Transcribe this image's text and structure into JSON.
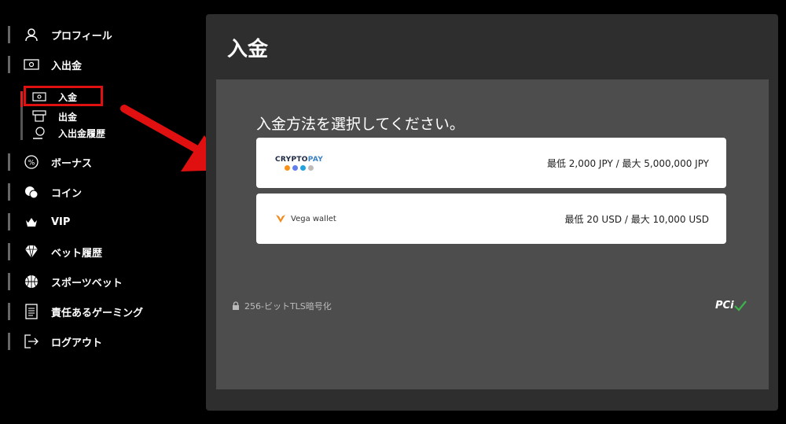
{
  "sidebar": {
    "items": [
      {
        "label": "プロフィール",
        "icon": "user-icon"
      },
      {
        "label": "入出金",
        "icon": "cash-icon"
      },
      {
        "label": "ボーナス",
        "icon": "percent-icon"
      },
      {
        "label": "コイン",
        "icon": "coins-icon"
      },
      {
        "label": "VIP",
        "icon": "vip-icon"
      },
      {
        "label": "ベット履歴",
        "icon": "diamond-icon"
      },
      {
        "label": "スポーツベット",
        "icon": "basketball-icon"
      },
      {
        "label": "責任あるゲーミング",
        "icon": "document-icon"
      },
      {
        "label": "ログアウト",
        "icon": "logout-icon"
      }
    ],
    "sub_items": [
      {
        "label": "入金",
        "icon": "cash-icon"
      },
      {
        "label": "出金",
        "icon": "atm-icon"
      },
      {
        "label": "入出金履歴",
        "icon": "history-icon"
      }
    ]
  },
  "main": {
    "title": "入金",
    "heading": "入金方法を選択してください。",
    "methods": [
      {
        "logo_text": "CRYPTO",
        "logo_text_accent": "PAY",
        "limit": "最低 2,000 JPY / 最大 5,000,000 JPY"
      },
      {
        "logo_text": "Vega wallet",
        "limit": "最低 20 USD / 最大 10,000 USD"
      }
    ],
    "security_note": "256-ビットTLS暗号化",
    "pci_label": "PCi"
  },
  "colors": {
    "accent": "#e01010",
    "panel": "#4d4d4d",
    "main_bg": "#2e2e2e"
  }
}
